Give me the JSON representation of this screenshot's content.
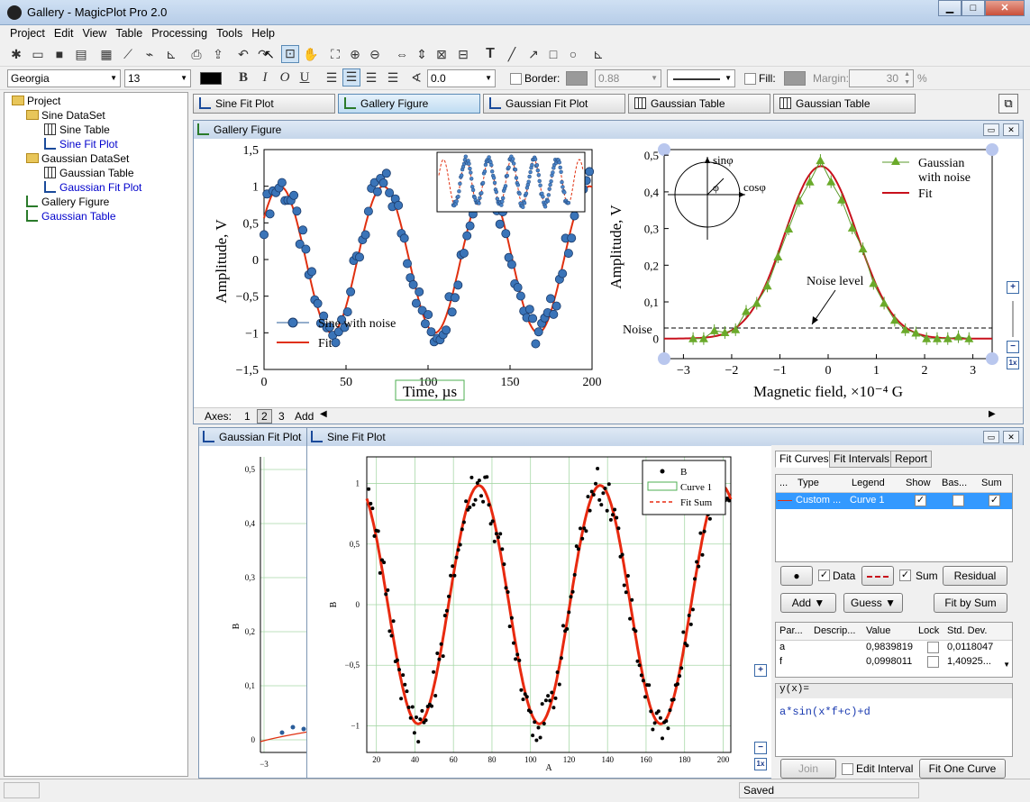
{
  "window": {
    "title": "Gallery - MagicPlot Pro 2.0",
    "minimize": "▁",
    "maximize": "□",
    "close": "✕"
  },
  "menu": [
    "Project",
    "Edit",
    "View",
    "Table",
    "Processing",
    "Tools",
    "Help"
  ],
  "format_toolbar": {
    "font": "Georgia",
    "size": "13",
    "bold": "B",
    "italic": "I",
    "overline": "O",
    "underline": "U",
    "angle": "0.0",
    "border_label": "Border:",
    "border_width": "0.88",
    "fill_label": "Fill:",
    "margin_label": "Margin:",
    "margin_value": "30",
    "margin_unit": "%"
  },
  "project_tree": [
    {
      "label": "Project",
      "kind": "root"
    },
    {
      "label": "Sine DataSet",
      "kind": "folder"
    },
    {
      "label": "Sine Table",
      "kind": "table"
    },
    {
      "label": "Sine Fit Plot",
      "kind": "plot"
    },
    {
      "label": "Gaussian DataSet",
      "kind": "folder"
    },
    {
      "label": "Gaussian Table",
      "kind": "table"
    },
    {
      "label": "Gaussian Fit Plot",
      "kind": "plot"
    },
    {
      "label": "Gallery Figure",
      "kind": "figure"
    },
    {
      "label": "Gaussian Table",
      "kind": "table"
    }
  ],
  "doc_tabs": [
    "Sine Fit Plot",
    "Gallery Figure",
    "Gaussian Fit Plot",
    "Gaussian Table",
    "Gaussian Table"
  ],
  "gallery": {
    "title": "Gallery Figure",
    "axes_label": "Axes:",
    "axes_items": [
      "1",
      "2",
      "3"
    ],
    "axes_add": "Add",
    "left_plot": {
      "ylabel": "Amplitude, V",
      "xlabel": "Time, µs",
      "yticks": [
        "1,5",
        "1",
        "0,5",
        "0",
        "−0,5",
        "−1",
        "−1,5"
      ],
      "xticks": [
        "0",
        "50",
        "100",
        "150",
        "200"
      ],
      "legend": [
        "Sine with noise",
        "Fit"
      ]
    },
    "right_plot": {
      "ylabel": "Amplitude, V",
      "xlabel": "Magnetic field, ×10⁻⁴ G",
      "yticks": [
        "0,5",
        "0,4",
        "0,3",
        "0,2",
        "0,1",
        "0"
      ],
      "xticks": [
        "−3",
        "−2",
        "−1",
        "0",
        "1",
        "2",
        "3"
      ],
      "legend": [
        "Gaussian",
        "with noise",
        "Fit"
      ],
      "annotation": "Noise level",
      "noise_label": "Noise",
      "inset": {
        "sin": "sinφ",
        "cos": "cosφ",
        "phi": "φ"
      }
    }
  },
  "gaussian_window": {
    "title": "Gaussian Fit Plot",
    "ylabel": "B",
    "yticks": [
      "0,5",
      "0,4",
      "0,3",
      "0,2",
      "0,1",
      "0"
    ],
    "xticks": [
      "−3"
    ]
  },
  "sine_window": {
    "title": "Sine Fit Plot",
    "xlabel": "A",
    "ylabel": "B",
    "yticks": [
      "1",
      "0,5",
      "0",
      "−0,5",
      "−1"
    ],
    "xticks": [
      "20",
      "40",
      "60",
      "80",
      "100",
      "120",
      "140",
      "160",
      "180",
      "200"
    ],
    "legend": [
      "B",
      "Curve 1",
      "Fit Sum"
    ]
  },
  "fit_panel": {
    "tabs": [
      "Fit Curves",
      "Fit Intervals",
      "Report"
    ],
    "curve_headers": [
      "...",
      "Type",
      "Legend",
      "Show",
      "Bas...",
      "Sum"
    ],
    "curve_row": {
      "type": "Custom ...",
      "legend": "Curve 1"
    },
    "data_label": "Data",
    "sum_label": "Sum",
    "residual": "Residual",
    "add": "Add ▼",
    "guess": "Guess ▼",
    "fit_by_sum": "Fit by Sum",
    "param_headers": [
      "Par...",
      "Descrip...",
      "Value",
      "Lock",
      "Std. Dev."
    ],
    "params": [
      {
        "name": "a",
        "value": "0,9839819",
        "std": "0,0118047"
      },
      {
        "name": "f",
        "value": "0,0998011",
        "std": "1,40925..."
      }
    ],
    "formula_label": "y(x)=",
    "formula": "a*sin(x*f+c)+d",
    "join": "Join",
    "edit_interval": "Edit Interval",
    "fit_one": "Fit One Curve"
  },
  "status": {
    "text": "Saved"
  },
  "colors": {
    "accent": "#3399ff",
    "fit_red": "#e03010",
    "sine_marker": "#2a5d9a",
    "gauss_green": "#5a9a2a"
  }
}
